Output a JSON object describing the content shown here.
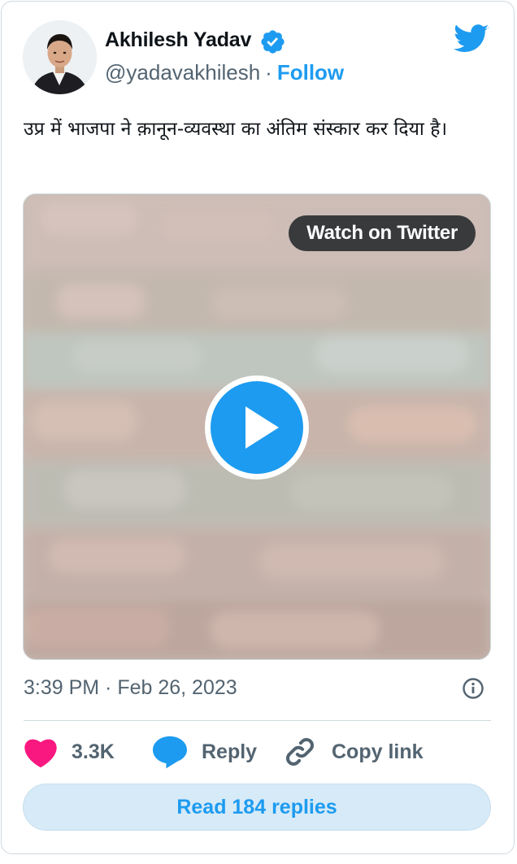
{
  "author": {
    "name": "Akhilesh Yadav",
    "handle": "@yadavakhilesh",
    "separator": "·",
    "follow_label": "Follow",
    "verified": true
  },
  "tweet": {
    "text": "उप्र में भाजपा ने क़ानून-व्यवस्था का अंतिम संस्कार कर दिया है।",
    "timestamp": "3:39 PM · Feb 26, 2023"
  },
  "media": {
    "type": "video",
    "watch_label": "Watch on Twitter"
  },
  "actions": {
    "likes": "3.3K",
    "reply_label": "Reply",
    "copy_label": "Copy link"
  },
  "read_replies_label": "Read 184 replies",
  "colors": {
    "brand": "#1d9bf0",
    "like": "#f91880",
    "muted_text": "#536471",
    "border": "#cfd9de"
  },
  "icons": [
    "avatar-photo",
    "verified-badge-icon",
    "twitter-bird-icon",
    "play-icon",
    "info-icon",
    "heart-icon",
    "speech-bubble-icon",
    "link-icon"
  ]
}
